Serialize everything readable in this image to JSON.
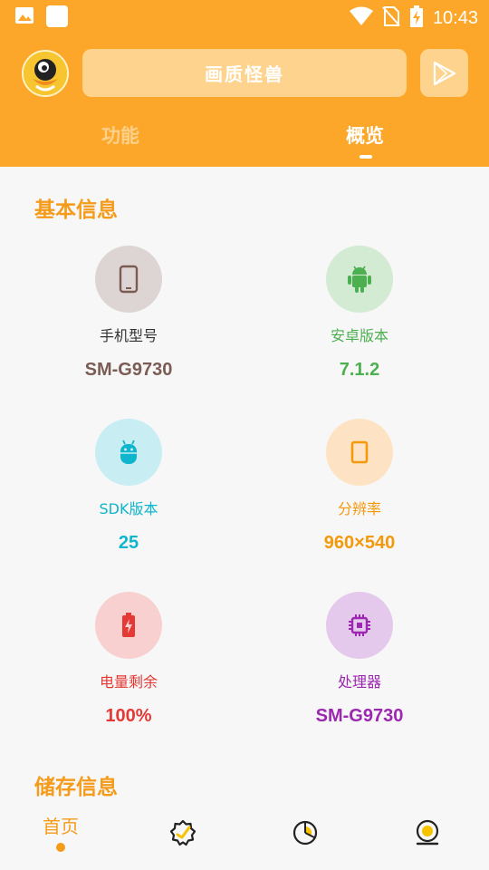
{
  "status_bar": {
    "time": "10:43",
    "icons": [
      "image-icon",
      "square-icon",
      "wifi-icon",
      "no-sim-icon",
      "battery-charging-icon"
    ]
  },
  "header": {
    "avatar": "mascot-avatar",
    "title": "画质怪兽",
    "action_icon": "play-store-icon",
    "tabs": [
      {
        "label": "功能",
        "active": false
      },
      {
        "label": "概览",
        "active": true
      }
    ]
  },
  "basic_info": {
    "title": "基本信息",
    "items": [
      {
        "label": "手机型号",
        "value": "SM-G9730",
        "icon": "phone-icon",
        "color": "#7b5c55",
        "bg": "#ddd5d3"
      },
      {
        "label": "安卓版本",
        "value": "7.1.2",
        "icon": "android-icon",
        "color": "#4caf50",
        "bg": "#d3ead3"
      },
      {
        "label": "SDK版本",
        "value": "25",
        "icon": "android-head-icon",
        "color": "#0eb5cc",
        "bg": "#c8eef4"
      },
      {
        "label": "分辨率",
        "value": "960×540",
        "icon": "screen-icon",
        "color": "#f5990c",
        "bg": "#fde3c4"
      },
      {
        "label": "电量剩余",
        "value": "100%",
        "icon": "battery-icon",
        "color": "#e53935",
        "bg": "#f8d0d0"
      },
      {
        "label": "处理器",
        "value": "SM-G9730",
        "icon": "cpu-icon",
        "color": "#9c27b0",
        "bg": "#e5c9ec"
      }
    ]
  },
  "storage_info": {
    "title": "储存信息"
  },
  "bottom_nav": {
    "items": [
      {
        "label": "首页",
        "icon": "home",
        "active": true
      },
      {
        "label": "",
        "icon": "verified-badge-icon",
        "active": false
      },
      {
        "label": "",
        "icon": "pie-chart-icon",
        "active": false
      },
      {
        "label": "",
        "icon": "profile-icon",
        "active": false
      }
    ]
  },
  "colors": {
    "accent": "#fca72a",
    "section_title": "#f59b1a",
    "background": "#f7f7f7"
  }
}
